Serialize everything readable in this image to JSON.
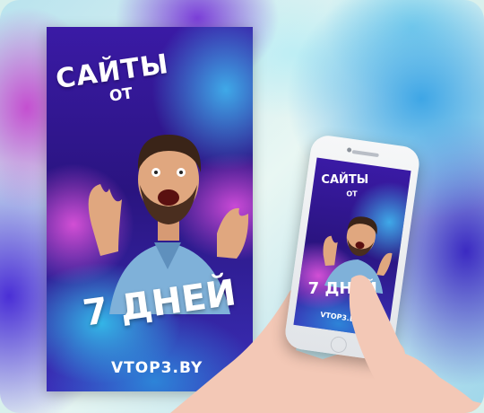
{
  "poster": {
    "title": "САЙТЫ",
    "from": "ОТ",
    "days": "7 ДНЕЙ",
    "site": "VTOP3.BY"
  },
  "phone_screen": {
    "title": "САЙТЫ",
    "from": "ОТ",
    "days": "7 ДНЕЙ",
    "site": "VTOP3.BY"
  },
  "colors": {
    "accent_purple": "#2a1480",
    "accent_blue": "#34b7e8",
    "accent_pink": "#c94ad6"
  }
}
